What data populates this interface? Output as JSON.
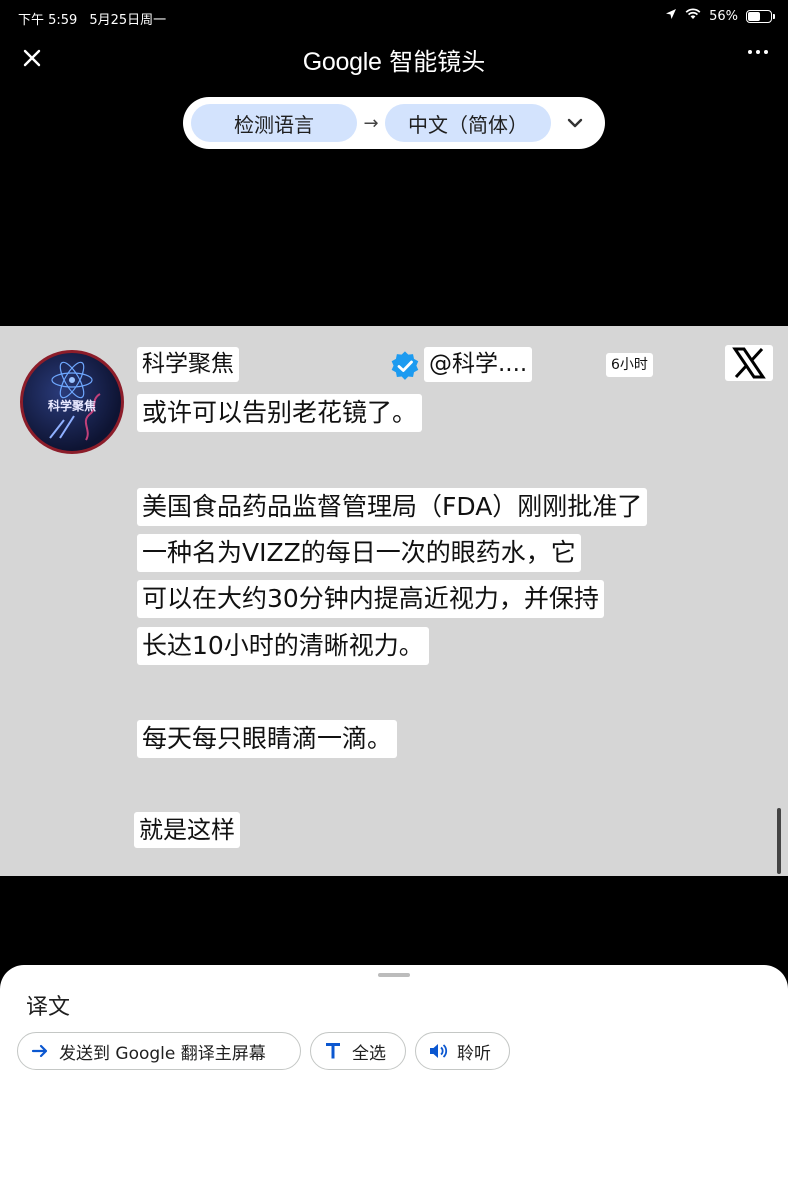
{
  "status_bar": {
    "time": "下午 5:59",
    "date": "5月25日周一",
    "battery_percent": "56%",
    "battery_level": 0.56
  },
  "header": {
    "title_brand": "Google",
    "title_product": "智能镜头"
  },
  "language": {
    "source": "检测语言",
    "arrow": "→",
    "target": "中文（简体）"
  },
  "post": {
    "avatar_text": "科学聚焦",
    "author": "科学聚焦",
    "handle": "@科学....",
    "time_ago": "6小时",
    "lines": [
      "或许可以告别老花镜了。",
      "美国食品药品监督管理局（FDA）刚刚批准了",
      "一种名为VIZZ的每日一次的眼药水，它",
      "可以在大约30分钟内提高近视力，并保持",
      "长达10小时的清晰视力。",
      "每天每只眼睛滴一滴。",
      "就是这样"
    ]
  },
  "sheet": {
    "title": "译文",
    "actions": [
      {
        "label": "发送到 Google 翻译主屏幕",
        "icon": "arrow-right-icon"
      },
      {
        "label": "全选",
        "icon": "text-icon"
      },
      {
        "label": "聆听",
        "icon": "speaker-icon"
      }
    ]
  },
  "colors": {
    "accent": "#0b57d0",
    "chip": "#d3e3fd",
    "verified": "#1d9bf0"
  }
}
